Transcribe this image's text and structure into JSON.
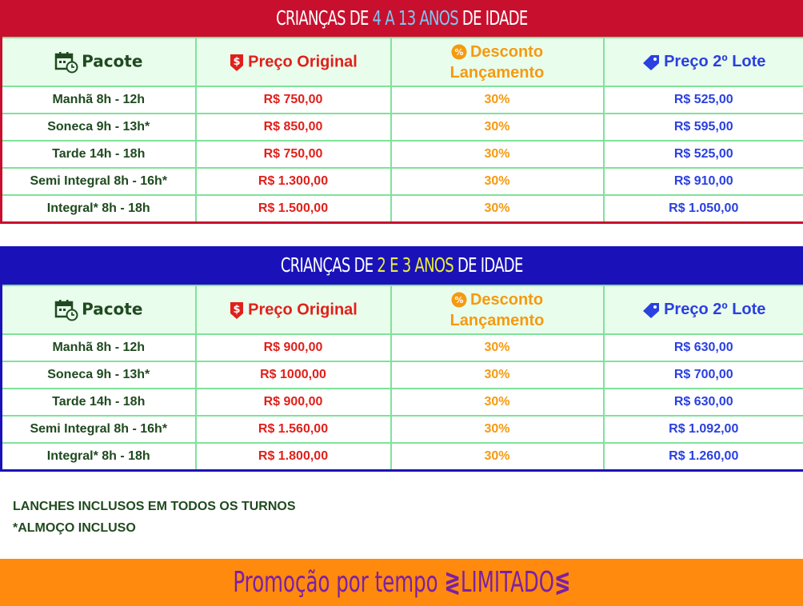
{
  "section1": {
    "banner": {
      "pre": "CRIANÇAS DE ",
      "highlight": "4 A 13 ANOS",
      "post": " DE IDADE"
    },
    "headers": {
      "pacote": "Pacote",
      "preco_original": "Preço Original",
      "desconto_line1": "Desconto",
      "desconto_line2": "Lançamento",
      "lote": "Preço 2º Lote"
    },
    "rows": [
      {
        "pacote": "Manhã 8h - 12h",
        "original": "R$ 750,00",
        "desconto": "30%",
        "lote": "R$ 525,00"
      },
      {
        "pacote": "Soneca 9h - 13h*",
        "original": "R$ 850,00",
        "desconto": "30%",
        "lote": "R$ 595,00"
      },
      {
        "pacote": "Tarde 14h - 18h",
        "original": "R$ 750,00",
        "desconto": "30%",
        "lote": "R$ 525,00"
      },
      {
        "pacote": "Semi Integral 8h - 16h*",
        "original": "R$ 1.300,00",
        "desconto": "30%",
        "lote": "R$ 910,00"
      },
      {
        "pacote": "Integral* 8h - 18h",
        "original": "R$ 1.500,00",
        "desconto": "30%",
        "lote": "R$ 1.050,00"
      }
    ]
  },
  "section2": {
    "banner": {
      "pre": "CRIANÇAS DE ",
      "highlight": "2 E 3 ANOS",
      "post": " DE IDADE"
    },
    "headers": {
      "pacote": "Pacote",
      "preco_original": "Preço Original",
      "desconto_line1": "Desconto",
      "desconto_line2": "Lançamento",
      "lote": "Preço 2º Lote"
    },
    "rows": [
      {
        "pacote": "Manhã 8h - 12h",
        "original": "R$ 900,00",
        "desconto": "30%",
        "lote": "R$ 630,00"
      },
      {
        "pacote": "Soneca 9h - 13h*",
        "original": "R$ 1000,00",
        "desconto": "30%",
        "lote": "R$ 700,00"
      },
      {
        "pacote": "Tarde 14h - 18h",
        "original": "R$ 900,00",
        "desconto": "30%",
        "lote": "R$ 630,00"
      },
      {
        "pacote": "Semi Integral 8h - 16h*",
        "original": "R$ 1.560,00",
        "desconto": "30%",
        "lote": "R$ 1.092,00"
      },
      {
        "pacote": "Integral* 8h - 18h",
        "original": "R$ 1.800,00",
        "desconto": "30%",
        "lote": "R$ 1.260,00"
      }
    ]
  },
  "notes": {
    "line1": "LANCHES INCLUSOS EM TODOS OS TURNOS",
    "line2": "*ALMOÇO INCLUSO"
  },
  "promo": {
    "pre": "Promoção por tempo",
    "highlight": "LIMITADO"
  },
  "icons": {
    "pacote": "calendar-clock-icon",
    "preco": "dollar-tag-icon",
    "desconto": "percent-badge-icon",
    "lote": "price-tag-icon"
  },
  "colors": {
    "red": "#c8102e",
    "blue": "#1a12b8",
    "orange": "#ff8a0d",
    "purple": "#7a1fa8",
    "green_border": "#7fe29a"
  }
}
